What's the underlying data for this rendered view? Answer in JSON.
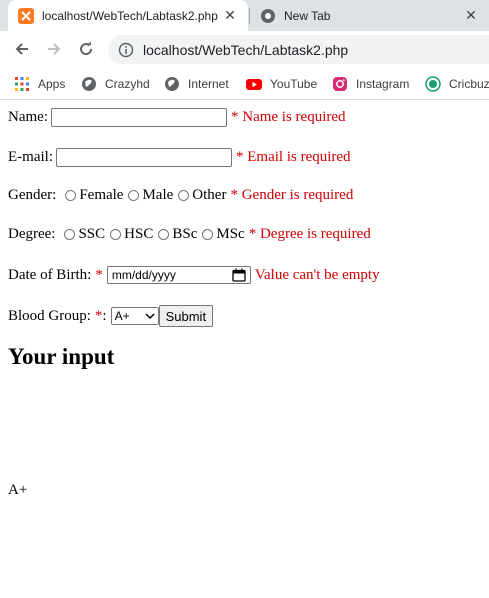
{
  "browser": {
    "tabs": [
      {
        "title": "localhost/WebTech/Labtask2.php",
        "close": "✕"
      },
      {
        "title": "New Tab",
        "close": "✕"
      }
    ],
    "url": "localhost/WebTech/Labtask2.php",
    "bookmarks": [
      {
        "label": "Apps",
        "icon": "apps-grid-icon"
      },
      {
        "label": "Crazyhd",
        "icon": "globe-icon"
      },
      {
        "label": "Internet",
        "icon": "globe-icon"
      },
      {
        "label": "YouTube",
        "icon": "youtube-icon"
      },
      {
        "label": "Instagram",
        "icon": "instagram-icon"
      },
      {
        "label": "Cricbuz",
        "icon": "cricbuzz-icon"
      }
    ]
  },
  "form": {
    "name": {
      "label": "Name:",
      "value": "",
      "error": "* Name is required"
    },
    "email": {
      "label": "E-mail:",
      "value": "",
      "error": "* Email is required"
    },
    "gender": {
      "label": "Gender:",
      "options": [
        "Female",
        "Male",
        "Other"
      ],
      "error": "* Gender is required"
    },
    "degree": {
      "label": "Degree:",
      "options": [
        "SSC",
        "HSC",
        "BSc",
        "MSc"
      ],
      "error": "* Degree is required"
    },
    "dob": {
      "label": "Date of Birth:",
      "star": "*",
      "placeholder": "mm/dd/yyyy",
      "error": "Value can't be empty"
    },
    "blood": {
      "label": "Blood Group:",
      "star": "*",
      "suffix": ":",
      "selected": "A+",
      "submit": "Submit"
    }
  },
  "output": {
    "heading": "Your input",
    "value": "A+"
  },
  "colors": {
    "error": "#d00000"
  }
}
